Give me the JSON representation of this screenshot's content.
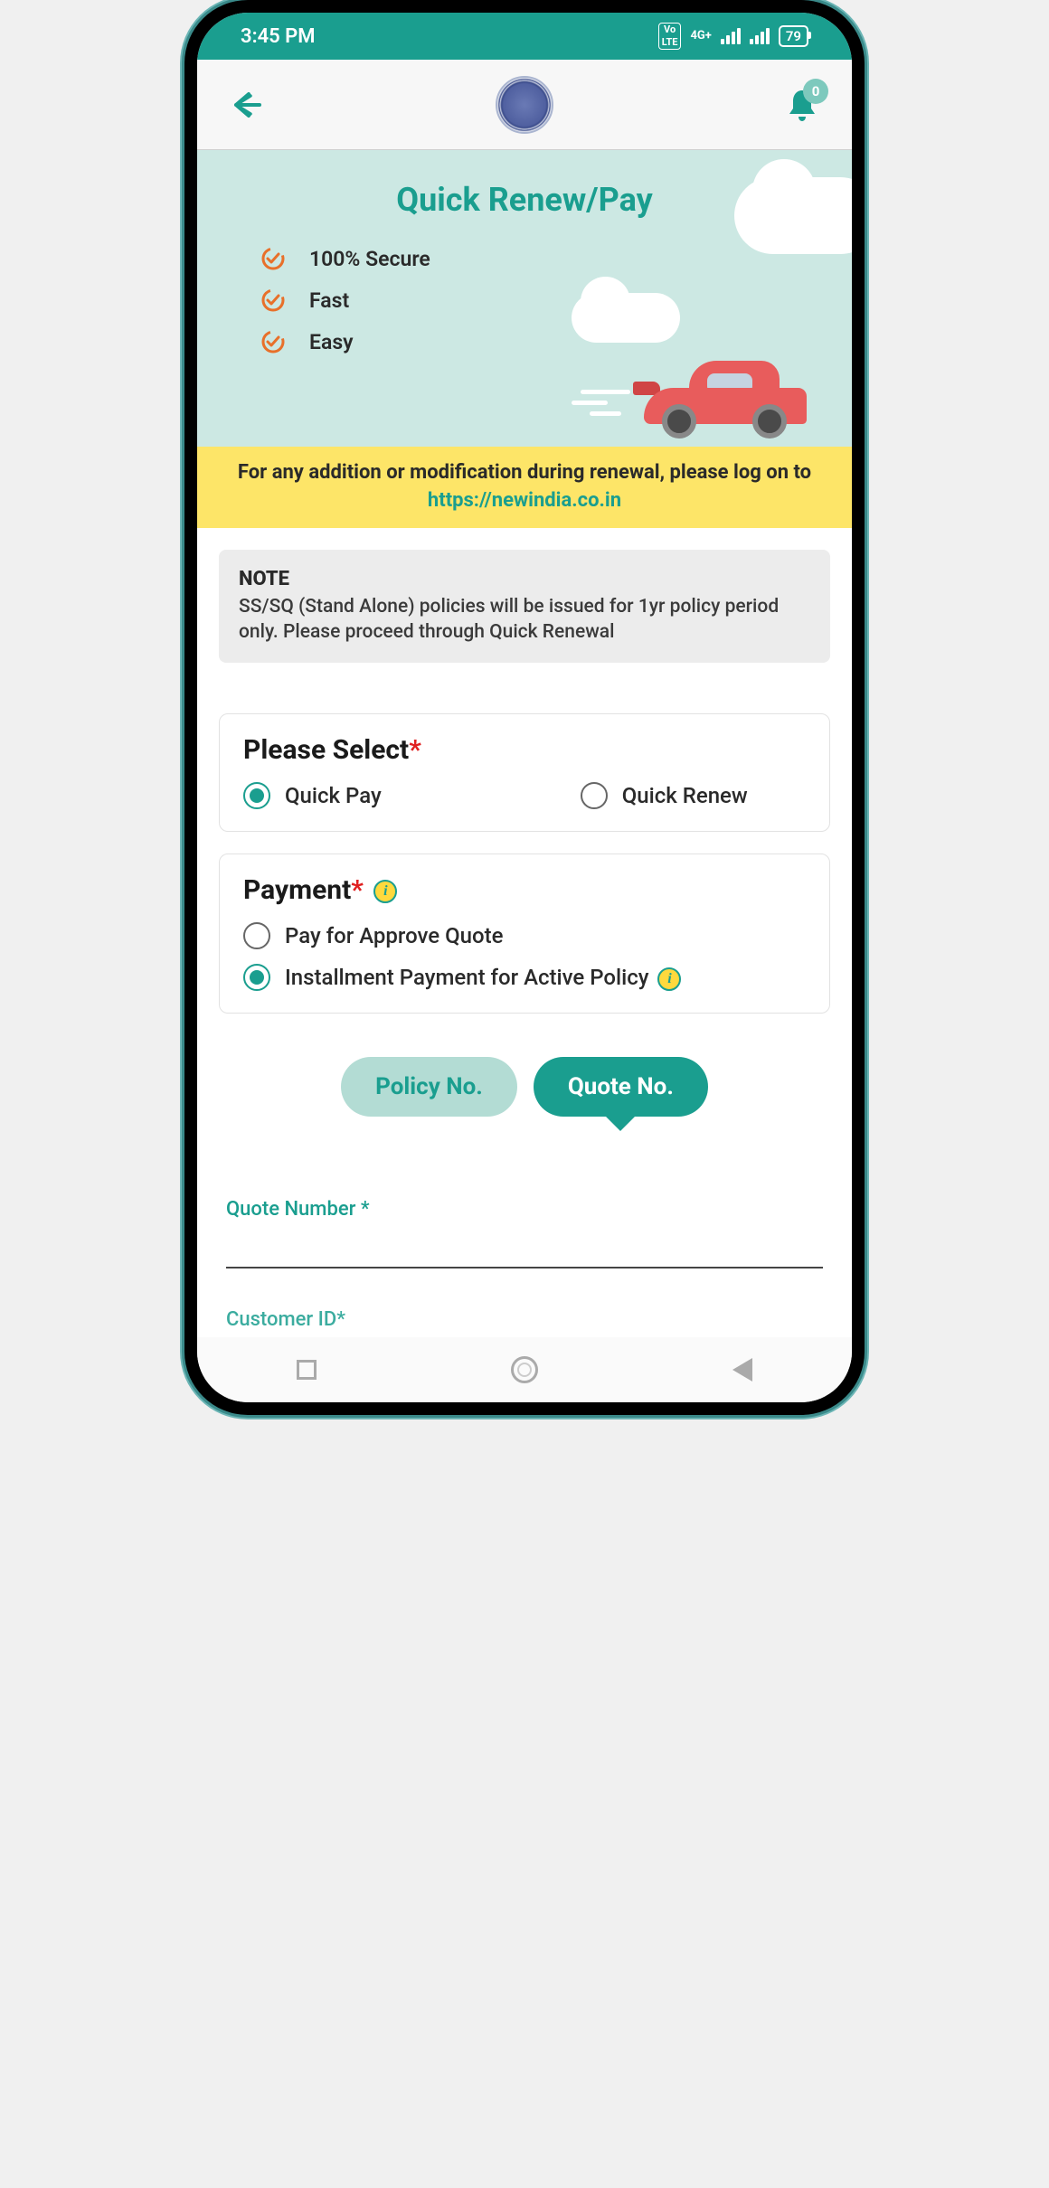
{
  "status": {
    "time": "3:45 PM",
    "volte": "Vo\nLTE",
    "conn": "4G+",
    "battery": "79"
  },
  "header": {
    "notif_count": "0"
  },
  "hero": {
    "title": "Quick Renew/Pay",
    "features": [
      "100% Secure",
      "Fast",
      "Easy"
    ]
  },
  "banner": {
    "text": "For any addition or modification during renewal, please log on to ",
    "link": "https://newindia.co.in"
  },
  "note": {
    "title": "NOTE",
    "text": "SS/SQ (Stand Alone) policies will be issued for 1yr policy period only. Please proceed through Quick Renewal"
  },
  "select": {
    "title": "Please Select",
    "options": [
      {
        "label": "Quick Pay",
        "checked": true
      },
      {
        "label": "Quick Renew",
        "checked": false
      }
    ]
  },
  "payment": {
    "title": "Payment",
    "options": [
      {
        "label": "Pay for Approve Quote",
        "checked": false,
        "info": false
      },
      {
        "label": "Installment Payment for Active Policy",
        "checked": true,
        "info": true
      }
    ]
  },
  "toggle": {
    "options": [
      {
        "label": "Policy No.",
        "active": false
      },
      {
        "label": "Quote No.",
        "active": true
      }
    ]
  },
  "fields": {
    "quote_label": "Quote Number *",
    "customer_label": "Customer ID*"
  }
}
